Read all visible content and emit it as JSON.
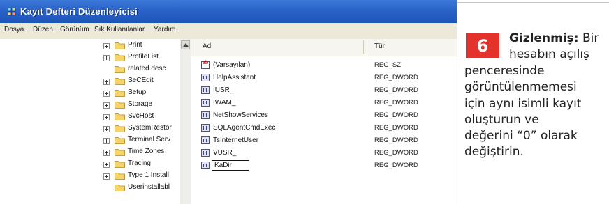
{
  "window": {
    "title": "Kayıt Defteri Düzenleyicisi",
    "icon": "regedit-icon"
  },
  "menu": [
    "Dosya",
    "Düzen",
    "Görünüm",
    "Sık Kullanılanlar",
    "Yardım"
  ],
  "tree": {
    "items": [
      {
        "label": "Print",
        "expander": true
      },
      {
        "label": "ProfileList",
        "expander": true
      },
      {
        "label": "related.desc",
        "expander": false
      },
      {
        "label": "SeCEdit",
        "expander": true
      },
      {
        "label": "Setup",
        "expander": true
      },
      {
        "label": "Storage",
        "expander": true
      },
      {
        "label": "SvcHost",
        "expander": true
      },
      {
        "label": "SystemRestor",
        "expander": true
      },
      {
        "label": "Terminal Serv",
        "expander": true
      },
      {
        "label": "Time Zones",
        "expander": true
      },
      {
        "label": "Tracing",
        "expander": true
      },
      {
        "label": "Type 1 Install",
        "expander": true
      },
      {
        "label": "Userinstallabl",
        "expander": false
      }
    ]
  },
  "list": {
    "columns": {
      "name": "Ad",
      "type": "Tür"
    },
    "rows": [
      {
        "name": "(Varsayılan)",
        "type": "REG_SZ",
        "icon": "string-value-icon"
      },
      {
        "name": "HelpAssistant",
        "type": "REG_DWORD",
        "icon": "dword-value-icon"
      },
      {
        "name": "IUSR_",
        "type": "REG_DWORD",
        "icon": "dword-value-icon"
      },
      {
        "name": "IWAM_",
        "type": "REG_DWORD",
        "icon": "dword-value-icon"
      },
      {
        "name": "NetShowServices",
        "type": "REG_DWORD",
        "icon": "dword-value-icon"
      },
      {
        "name": "SQLAgentCmdExec",
        "type": "REG_DWORD",
        "icon": "dword-value-icon"
      },
      {
        "name": "TsInternetUser",
        "type": "REG_DWORD",
        "icon": "dword-value-icon"
      },
      {
        "name": "VUSR_",
        "type": "REG_DWORD",
        "icon": "dword-value-icon"
      },
      {
        "name": "KaDir",
        "type": "REG_DWORD",
        "icon": "dword-value-icon",
        "editing": true
      }
    ]
  },
  "caption": {
    "step": "6",
    "heading": "Gizlenmiş:",
    "lines": [
      "Bir",
      "hesabın açılış",
      "penceresinde",
      "görüntülenmemesi",
      "için aynı isimli kayıt",
      "oluşturun ve",
      "değerini “0” olarak",
      "değiştirin."
    ]
  },
  "colors": {
    "titlebar": "#2a63c8",
    "badge": "#e3322b",
    "menubar": "#ece9d8"
  }
}
